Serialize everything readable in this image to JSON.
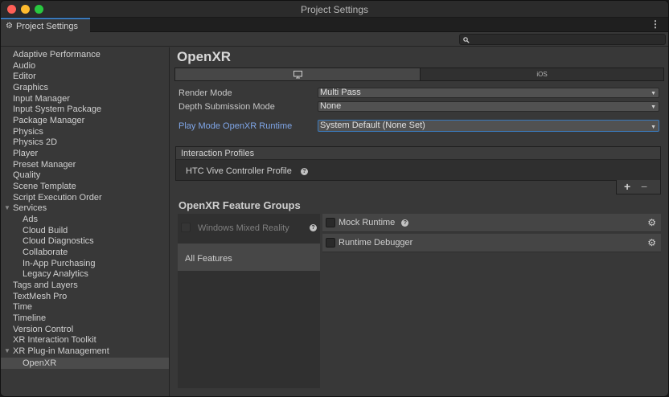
{
  "window": {
    "title": "Project Settings"
  },
  "tab": {
    "label": "Project Settings"
  },
  "sidebar": {
    "items": [
      {
        "label": "Adaptive Performance"
      },
      {
        "label": "Audio"
      },
      {
        "label": "Editor"
      },
      {
        "label": "Graphics"
      },
      {
        "label": "Input Manager"
      },
      {
        "label": "Input System Package"
      },
      {
        "label": "Package Manager"
      },
      {
        "label": "Physics"
      },
      {
        "label": "Physics 2D"
      },
      {
        "label": "Player"
      },
      {
        "label": "Preset Manager"
      },
      {
        "label": "Quality"
      },
      {
        "label": "Scene Template"
      },
      {
        "label": "Script Execution Order"
      },
      {
        "label": "Services"
      },
      {
        "label": "Ads"
      },
      {
        "label": "Cloud Build"
      },
      {
        "label": "Cloud Diagnostics"
      },
      {
        "label": "Collaborate"
      },
      {
        "label": "In-App Purchasing"
      },
      {
        "label": "Legacy Analytics"
      },
      {
        "label": "Tags and Layers"
      },
      {
        "label": "TextMesh Pro"
      },
      {
        "label": "Time"
      },
      {
        "label": "Timeline"
      },
      {
        "label": "Version Control"
      },
      {
        "label": "XR Interaction Toolkit"
      },
      {
        "label": "XR Plug-in Management"
      },
      {
        "label": "OpenXR"
      }
    ],
    "selected": "OpenXR"
  },
  "main": {
    "title": "OpenXR",
    "platform_tabs": [
      {
        "icon": "monitor-icon",
        "label": ""
      },
      {
        "label": "iOS"
      }
    ],
    "fields": {
      "render_mode": {
        "label": "Render Mode",
        "value": "Multi Pass"
      },
      "depth_submission": {
        "label": "Depth Submission Mode",
        "value": "None"
      },
      "play_mode_runtime": {
        "label": "Play Mode OpenXR Runtime",
        "value": "System Default (None Set)"
      }
    },
    "interaction_profiles": {
      "header": "Interaction Profiles",
      "items": [
        {
          "label": "HTC Vive Controller Profile"
        }
      ]
    },
    "feature_groups": {
      "title": "OpenXR Feature Groups",
      "groups": [
        {
          "label": "Windows Mixed Reality",
          "enabled": false
        },
        {
          "label": "All Features",
          "selected": true
        }
      ],
      "features": [
        {
          "label": "Mock Runtime",
          "checked": false
        },
        {
          "label": "Runtime Debugger",
          "checked": false
        }
      ]
    }
  },
  "colors": {
    "accent": "#3a79bb",
    "link": "#7fa6e8",
    "panel": "#383838"
  }
}
